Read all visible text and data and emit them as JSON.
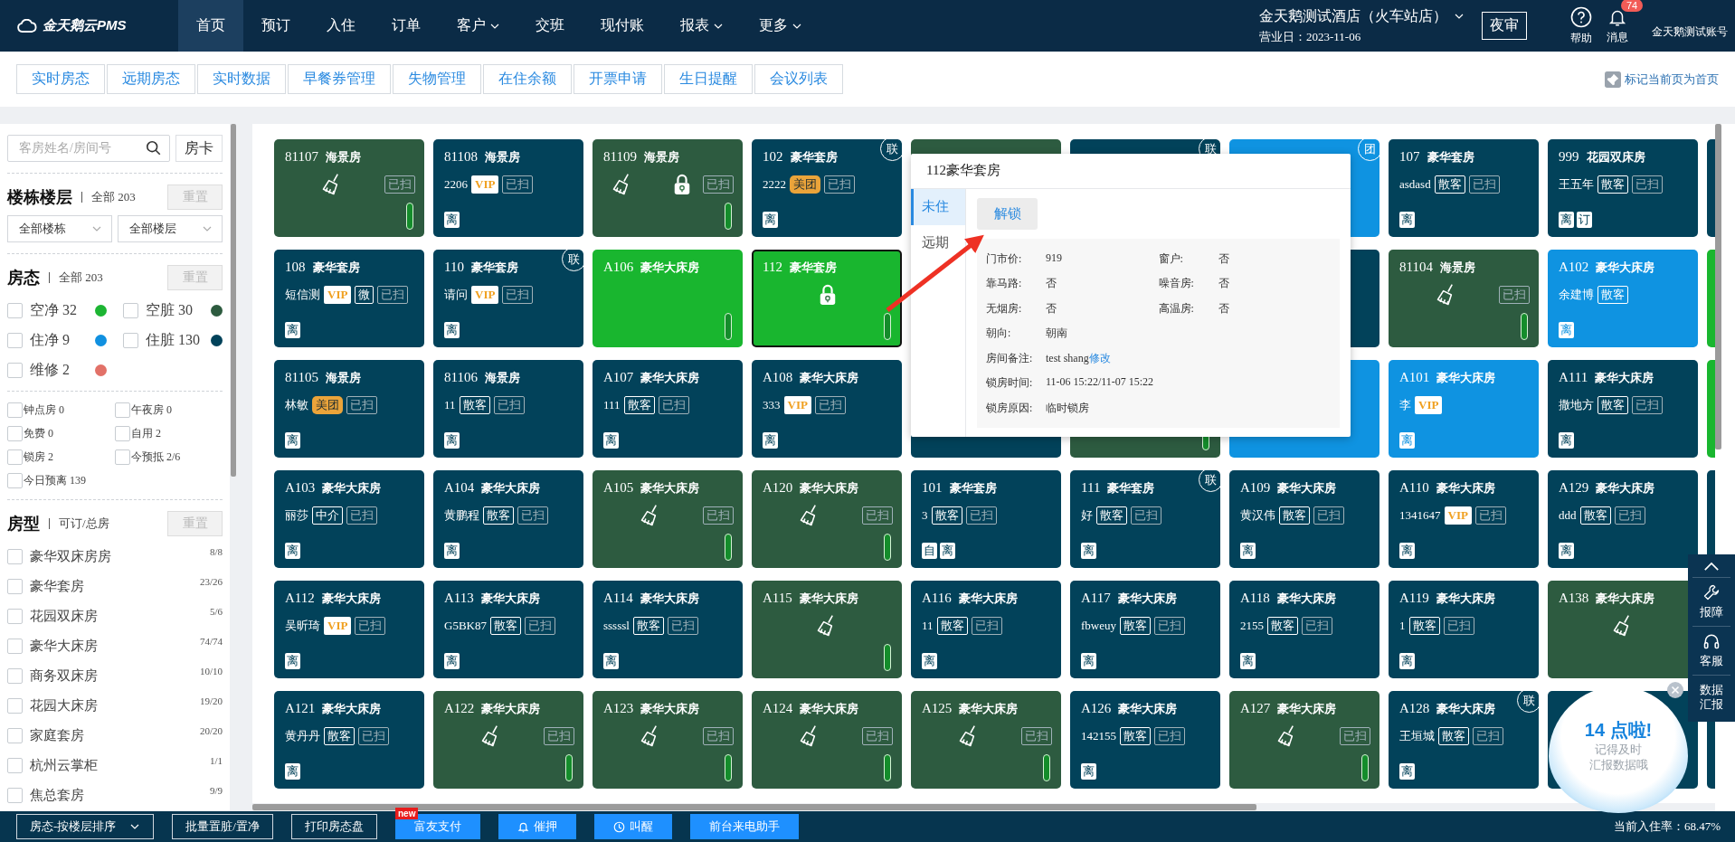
{
  "nav": {
    "logo": "金天鹅云PMS",
    "items": [
      {
        "label": "首页",
        "selected": true
      },
      {
        "label": "预订",
        "selected": false
      },
      {
        "label": "入住",
        "selected": false
      },
      {
        "label": "订单",
        "selected": false
      },
      {
        "label": "客户",
        "selected": false,
        "dropdown": true
      },
      {
        "label": "交班",
        "selected": false
      },
      {
        "label": "现付账",
        "selected": false
      },
      {
        "label": "报表",
        "selected": false,
        "dropdown": true
      },
      {
        "label": "更多",
        "selected": false,
        "dropdown": true
      }
    ],
    "hotel": "金天鹅测试酒店（火车站店）",
    "business_date": "营业日：2023-11-06",
    "night_audit": "夜审",
    "help": "帮助",
    "messages": "消息",
    "message_count": "74",
    "account": "金天鹅测试账号"
  },
  "tabs": [
    {
      "label": "实时房态",
      "selected": false
    },
    {
      "label": "远期房态",
      "selected": false
    },
    {
      "label": "实时数据",
      "selected": false
    },
    {
      "label": "早餐券管理",
      "selected": false
    },
    {
      "label": "失物管理",
      "selected": false
    },
    {
      "label": "在住余额",
      "selected": false
    },
    {
      "label": "开票申请",
      "selected": false
    },
    {
      "label": "生日提醒",
      "selected": false
    },
    {
      "label": "会议列表",
      "selected": false
    }
  ],
  "bookmark": "标记当前页为首页",
  "sidebar": {
    "search": {
      "placeholder": "客房姓名/房间号"
    },
    "room_card": "房卡",
    "building": {
      "title": "楼栋楼层",
      "subtitle": "全部 203",
      "reset": "重置",
      "selects": [
        "全部楼栋",
        "全部楼层"
      ]
    },
    "status": {
      "title": "房态",
      "subtitle": "全部 203",
      "reset": "重置",
      "legend": [
        {
          "label": "空净 32",
          "color": "#1db533",
          "checked": false
        },
        {
          "label": "空脏 30",
          "color": "#2d5b3f",
          "checked": false
        },
        {
          "label": "住净 9",
          "color": "#1090e0",
          "checked": false
        },
        {
          "label": "住脏 130",
          "color": "#01425a",
          "checked": false
        },
        {
          "label": "维修 2",
          "color": "#e27168",
          "checked": false
        }
      ],
      "flags": [
        {
          "label": "钟点房 0",
          "checked": false
        },
        {
          "label": "午夜房 0",
          "checked": false
        },
        {
          "label": "免费 0",
          "checked": false
        },
        {
          "label": "自用 2",
          "checked": false
        },
        {
          "label": "锁房 2",
          "checked": false
        },
        {
          "label": "今预抵 2/6",
          "checked": false
        },
        {
          "label": "今日预离 139",
          "checked": false
        }
      ]
    },
    "room_types": {
      "title": "房型",
      "subtitle": "可订/总房",
      "reset": "重置",
      "items": [
        {
          "label": "豪华双床房房",
          "count": "8/8",
          "checked": false
        },
        {
          "label": "豪华套房",
          "count": "23/26",
          "checked": false
        },
        {
          "label": "花园双床房",
          "count": "5/6",
          "checked": false
        },
        {
          "label": "豪华大床房",
          "count": "74/74",
          "checked": false
        },
        {
          "label": "商务双床房",
          "count": "10/10",
          "checked": false
        },
        {
          "label": "花园大床房",
          "count": "19/20",
          "checked": false
        },
        {
          "label": "家庭套房",
          "count": "20/20",
          "checked": false
        },
        {
          "label": "杭州云掌柜",
          "count": "1/1",
          "checked": false
        },
        {
          "label": "焦总套房",
          "count": "9/9",
          "checked": false
        }
      ]
    }
  },
  "rooms": [
    {
      "number": "81107",
      "type": "海景房",
      "kind": "vd",
      "broom": true,
      "scanned": "已扫",
      "bar": true,
      "selected": false
    },
    {
      "number": "81108",
      "type": "海景房",
      "kind": "od",
      "guest": "2206",
      "tags": [
        {
          "kind": "vip",
          "text": "VIP"
        }
      ],
      "scanned": "已扫",
      "badges": [
        "离"
      ],
      "selected": false
    },
    {
      "number": "81109",
      "type": "海景房",
      "kind": "vd",
      "broom": true,
      "lock": true,
      "scanned": "已扫",
      "bar": true,
      "selected": false
    },
    {
      "number": "102",
      "type": "豪华套房",
      "kind": "od",
      "guest": "2222",
      "tags": [
        {
          "kind": "ota",
          "text": "美团"
        }
      ],
      "scanned": "已扫",
      "badges": [
        "离"
      ],
      "corner": "联",
      "selected": false
    },
    {
      "kind": "vd"
    },
    {
      "kind": "od",
      "corner": "联"
    },
    {
      "kind": "oc",
      "corner": "团"
    },
    {
      "number": "107",
      "type": "豪华套房",
      "kind": "od",
      "guest": "asdasd",
      "tags": [
        {
          "kind": "plain",
          "text": "散客"
        }
      ],
      "scanned": "已扫",
      "badges": [
        "离"
      ],
      "selected": false
    },
    {
      "number": "999",
      "type": "花园双床房",
      "kind": "od",
      "guest": "王五年",
      "tags": [
        {
          "kind": "plain",
          "text": "散客"
        }
      ],
      "scanned": "已扫",
      "badges": [
        "离",
        "订"
      ],
      "selected": false
    },
    {
      "kind": "od"
    },
    {
      "number": "108",
      "type": "豪华套房",
      "kind": "od",
      "guest": "短信测",
      "tags": [
        {
          "kind": "vip",
          "text": "VIP"
        },
        {
          "kind": "plain",
          "text": "微"
        }
      ],
      "scanned": "已扫",
      "badges": [
        "离"
      ],
      "selected": false
    },
    {
      "number": "110",
      "type": "豪华套房",
      "kind": "od",
      "guest": "请问",
      "tags": [
        {
          "kind": "vip",
          "text": "VIP"
        }
      ],
      "scanned": "已扫",
      "badges": [
        "离"
      ],
      "corner": "联",
      "selected": false
    },
    {
      "number": "A106",
      "type": "豪华大床房",
      "kind": "vc",
      "bar": true,
      "selected": false
    },
    {
      "number": "112",
      "type": "豪华套房",
      "kind": "vc",
      "lock": true,
      "bar": true,
      "selected": true
    },
    {
      "kind": "od"
    },
    {
      "number": "81104",
      "type": "海景房",
      "kind": "vd",
      "broom": true,
      "scanned": "已扫",
      "bar": true,
      "selected": false
    },
    {
      "number": "A102",
      "type": "豪华大床房",
      "kind": "oc",
      "guest": "余建博",
      "tags": [
        {
          "kind": "plain",
          "text": "散客"
        }
      ],
      "badges": [
        "离"
      ],
      "selected": false
    },
    {
      "kind": "vc"
    },
    {
      "number": "81105",
      "type": "海景房",
      "kind": "od",
      "guest": "林敏",
      "tags": [
        {
          "kind": "ota",
          "text": "美团"
        }
      ],
      "scanned": "已扫",
      "badges": [
        "离"
      ],
      "selected": false
    },
    {
      "number": "81106",
      "type": "海景房",
      "kind": "od",
      "guest": "11",
      "tags": [
        {
          "kind": "plain",
          "text": "散客"
        }
      ],
      "scanned": "已扫",
      "badges": [
        "离"
      ],
      "selected": false
    },
    {
      "number": "A107",
      "type": "豪华大床房",
      "kind": "od",
      "guest": "111",
      "tags": [
        {
          "kind": "plain",
          "text": "散客"
        }
      ],
      "scanned": "已扫",
      "badges": [
        "离"
      ],
      "selected": false
    },
    {
      "number": "A108",
      "type": "豪华大床房",
      "kind": "od",
      "guest": "333",
      "tags": [
        {
          "kind": "vip",
          "text": "VIP"
        }
      ],
      "scanned": "已扫",
      "badges": [
        "离"
      ],
      "selected": false
    },
    {
      "kind": "od"
    },
    {
      "kind": "vd",
      "bar": true
    },
    {
      "kind": "oc"
    },
    {
      "number": "A101",
      "type": "豪华大床房",
      "kind": "oc",
      "guest": "李",
      "tags": [
        {
          "kind": "vip",
          "text": "VIP"
        }
      ],
      "badges": [
        "离"
      ],
      "selected": false
    },
    {
      "number": "A111",
      "type": "豪华大床房",
      "kind": "od",
      "guest": "撒地方",
      "tags": [
        {
          "kind": "plain",
          "text": "散客"
        }
      ],
      "scanned": "已扫",
      "badges": [
        "离"
      ],
      "selected": false
    },
    {
      "kind": "vc"
    },
    {
      "number": "A103",
      "type": "豪华大床房",
      "kind": "od",
      "guest": "丽莎",
      "tags": [
        {
          "kind": "plain",
          "text": "中介"
        }
      ],
      "scanned": "已扫",
      "badges": [
        "离"
      ],
      "selected": false
    },
    {
      "number": "A104",
      "type": "豪华大床房",
      "kind": "od",
      "guest": "黄鹏程",
      "tags": [
        {
          "kind": "plain",
          "text": "散客"
        }
      ],
      "scanned": "已扫",
      "badges": [
        "离"
      ],
      "selected": false
    },
    {
      "number": "A105",
      "type": "豪华大床房",
      "kind": "vd",
      "broom": true,
      "scanned": "已扫",
      "bar": true,
      "selected": false
    },
    {
      "number": "A120",
      "type": "豪华大床房",
      "kind": "vd",
      "broom": true,
      "scanned": "已扫",
      "bar": true,
      "selected": false
    },
    {
      "number": "101",
      "type": "豪华套房",
      "kind": "od",
      "guest": "3",
      "tags": [
        {
          "kind": "plain",
          "text": "散客"
        }
      ],
      "scanned": "已扫",
      "badges": [
        "自",
        "离"
      ],
      "selected": false
    },
    {
      "number": "111",
      "type": "豪华套房",
      "kind": "od",
      "guest": "好",
      "tags": [
        {
          "kind": "plain",
          "text": "散客"
        }
      ],
      "scanned": "已扫",
      "badges": [
        "离"
      ],
      "corner": "联",
      "selected": false
    },
    {
      "number": "A109",
      "type": "豪华大床房",
      "kind": "od",
      "guest": "黄汉伟",
      "tags": [
        {
          "kind": "plain",
          "text": "散客"
        }
      ],
      "scanned": "已扫",
      "badges": [
        "离"
      ],
      "selected": false
    },
    {
      "number": "A110",
      "type": "豪华大床房",
      "kind": "od",
      "guest": "1341647",
      "tags": [
        {
          "kind": "vip",
          "text": "VIP"
        }
      ],
      "scanned": "已扫",
      "badges": [
        "离"
      ],
      "selected": false
    },
    {
      "number": "A129",
      "type": "豪华大床房",
      "kind": "od",
      "guest": "ddd",
      "tags": [
        {
          "kind": "plain",
          "text": "散客"
        }
      ],
      "scanned": "已扫",
      "badges": [
        "离"
      ],
      "selected": false
    },
    {
      "kind": "od"
    },
    {
      "number": "A112",
      "type": "豪华大床房",
      "kind": "od",
      "guest": "吴昕琦",
      "tags": [
        {
          "kind": "vip",
          "text": "VIP"
        }
      ],
      "scanned": "已扫",
      "badges": [
        "离"
      ],
      "selected": false
    },
    {
      "number": "A113",
      "type": "豪华大床房",
      "kind": "od",
      "guest": "G5BK87",
      "tags": [
        {
          "kind": "plain",
          "text": "散客"
        }
      ],
      "scanned": "已扫",
      "badges": [
        "离"
      ],
      "selected": false
    },
    {
      "number": "A114",
      "type": "豪华大床房",
      "kind": "od",
      "guest": "sssssl",
      "tags": [
        {
          "kind": "plain",
          "text": "散客"
        }
      ],
      "scanned": "已扫",
      "badges": [
        "离"
      ],
      "selected": false
    },
    {
      "number": "A115",
      "type": "豪华大床房",
      "kind": "vd",
      "broom": true,
      "bar": true,
      "selected": false
    },
    {
      "number": "A116",
      "type": "豪华大床房",
      "kind": "od",
      "guest": "11",
      "tags": [
        {
          "kind": "plain",
          "text": "散客"
        }
      ],
      "scanned": "已扫",
      "badges": [
        "离"
      ],
      "selected": false
    },
    {
      "number": "A117",
      "type": "豪华大床房",
      "kind": "od",
      "guest": "fbweuy",
      "tags": [
        {
          "kind": "plain",
          "text": "散客"
        }
      ],
      "scanned": "已扫",
      "badges": [
        "离"
      ],
      "selected": false
    },
    {
      "number": "A118",
      "type": "豪华大床房",
      "kind": "od",
      "guest": "2155",
      "tags": [
        {
          "kind": "plain",
          "text": "散客"
        }
      ],
      "scanned": "已扫",
      "badges": [
        "离"
      ],
      "selected": false
    },
    {
      "number": "A119",
      "type": "豪华大床房",
      "kind": "od",
      "guest": "1",
      "tags": [
        {
          "kind": "plain",
          "text": "散客"
        }
      ],
      "scanned": "已扫",
      "badges": [
        "离"
      ],
      "selected": false
    },
    {
      "number": "A138",
      "type": "豪华大床房",
      "kind": "vd",
      "broom": true,
      "selected": false
    },
    {
      "number": "A121",
      "type": "豪华大床房",
      "kind": "od",
      "guest": "黄丹丹",
      "tags": [
        {
          "kind": "plain",
          "text": "散客"
        }
      ],
      "scanned": "已扫",
      "badges": [
        "离"
      ],
      "selected": false
    },
    {
      "number": "A122",
      "type": "豪华大床房",
      "kind": "vd",
      "broom": true,
      "scanned": "已扫",
      "bar": true,
      "selected": false
    },
    {
      "number": "A123",
      "type": "豪华大床房",
      "kind": "vd",
      "broom": true,
      "scanned": "已扫",
      "bar": true,
      "selected": false
    },
    {
      "number": "A124",
      "type": "豪华大床房",
      "kind": "vd",
      "broom": true,
      "scanned": "已扫",
      "bar": true,
      "selected": false
    },
    {
      "number": "A125",
      "type": "豪华大床房",
      "kind": "vd",
      "broom": true,
      "scanned": "已扫",
      "bar": true,
      "selected": false
    },
    {
      "number": "A126",
      "type": "豪华大床房",
      "kind": "od",
      "guest": "142155",
      "tags": [
        {
          "kind": "plain",
          "text": "散客"
        }
      ],
      "scanned": "已扫",
      "badges": [
        "离"
      ],
      "selected": false
    },
    {
      "number": "A127",
      "type": "豪华大床房",
      "kind": "vd",
      "broom": true,
      "scanned": "已扫",
      "bar": true,
      "selected": false
    },
    {
      "number": "A128",
      "type": "豪华大床房",
      "kind": "od",
      "guest": "王垣城",
      "tags": [
        {
          "kind": "plain",
          "text": "散客"
        }
      ],
      "scanned": "已扫",
      "badges": [
        "离"
      ],
      "corner": "联",
      "selected": false
    },
    {
      "kind": "od"
    },
    {
      "kind": "od"
    }
  ],
  "popup": {
    "title": "112豪华套房",
    "tabs": [
      {
        "label": "未住",
        "selected": true
      },
      {
        "label": "远期",
        "selected": false
      }
    ],
    "action": "解锁",
    "rows": [
      [
        {
          "label": "门市价:",
          "value": "919"
        },
        {
          "label": "窗户:",
          "value": "否"
        }
      ],
      [
        {
          "label": "靠马路:",
          "value": "否"
        },
        {
          "label": "噪音房:",
          "value": "否"
        }
      ],
      [
        {
          "label": "无烟房:",
          "value": "否"
        },
        {
          "label": "高温房:",
          "value": "否"
        }
      ],
      [
        {
          "label": "朝向:",
          "value": "朝南"
        }
      ],
      [
        {
          "label": "房间备注:",
          "value": "test shang",
          "link": "修改"
        }
      ],
      [
        {
          "label": "锁房时间:",
          "value": "11-06 15:22/11-07 15:22"
        }
      ],
      [
        {
          "label": "锁房原因:",
          "value": "临时锁房"
        }
      ]
    ]
  },
  "side_tools": [
    {
      "kind": "top"
    },
    {
      "kind": "wrench",
      "label": "报障"
    },
    {
      "kind": "headset",
      "label": "客服"
    },
    {
      "kind": "text",
      "label": "数据汇报"
    }
  ],
  "reminder": {
    "title": "14 点啦!",
    "lines": [
      "记得及时",
      "汇报数据哦"
    ]
  },
  "bottom_bar": {
    "buttons": [
      {
        "kind": "dropdown",
        "label": "房态-按楼层排序"
      },
      {
        "kind": "outline",
        "label": "批量置脏/置净"
      },
      {
        "kind": "outline",
        "label": "打印房态盘"
      },
      {
        "kind": "primary",
        "label": "富友支付",
        "badge": "new"
      },
      {
        "kind": "remind",
        "label": "催押"
      },
      {
        "kind": "wakeup",
        "label": "叫醒"
      },
      {
        "kind": "primary",
        "label": "前台来电助手"
      }
    ],
    "occupancy": "当前入住率：68.47%"
  }
}
